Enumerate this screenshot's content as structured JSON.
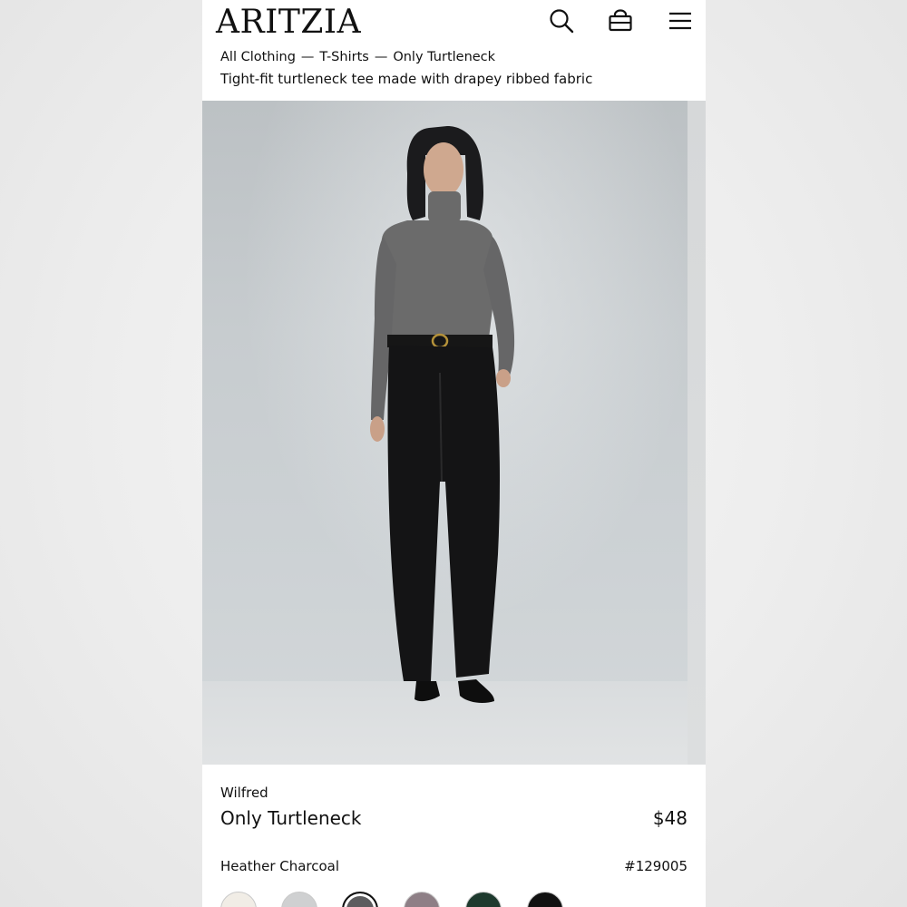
{
  "header": {
    "logo": "ARITZIA",
    "icons": [
      "search-icon",
      "bag-icon",
      "menu-icon"
    ]
  },
  "breadcrumb": {
    "items": [
      "All Clothing",
      "T-Shirts",
      "Only Turtleneck"
    ],
    "separator": "—"
  },
  "product": {
    "description": "Tight-fit turtleneck tee made with drapey ribbed fabric",
    "brand": "Wilfred",
    "name": "Only Turtleneck",
    "price": "$48",
    "color_name": "Heather Charcoal",
    "sku": "#129005"
  },
  "swatches": [
    {
      "name": "cream",
      "color": "#f1ede6",
      "selected": false
    },
    {
      "name": "light-heather-grey",
      "color": "#cfd0d1",
      "selected": false
    },
    {
      "name": "heather-charcoal",
      "color": "#5c5c5e",
      "selected": true
    },
    {
      "name": "mauve",
      "color": "#8e7f86",
      "selected": false
    },
    {
      "name": "dark-green",
      "color": "#1e3a2e",
      "selected": false
    },
    {
      "name": "black",
      "color": "#111111",
      "selected": false
    }
  ]
}
